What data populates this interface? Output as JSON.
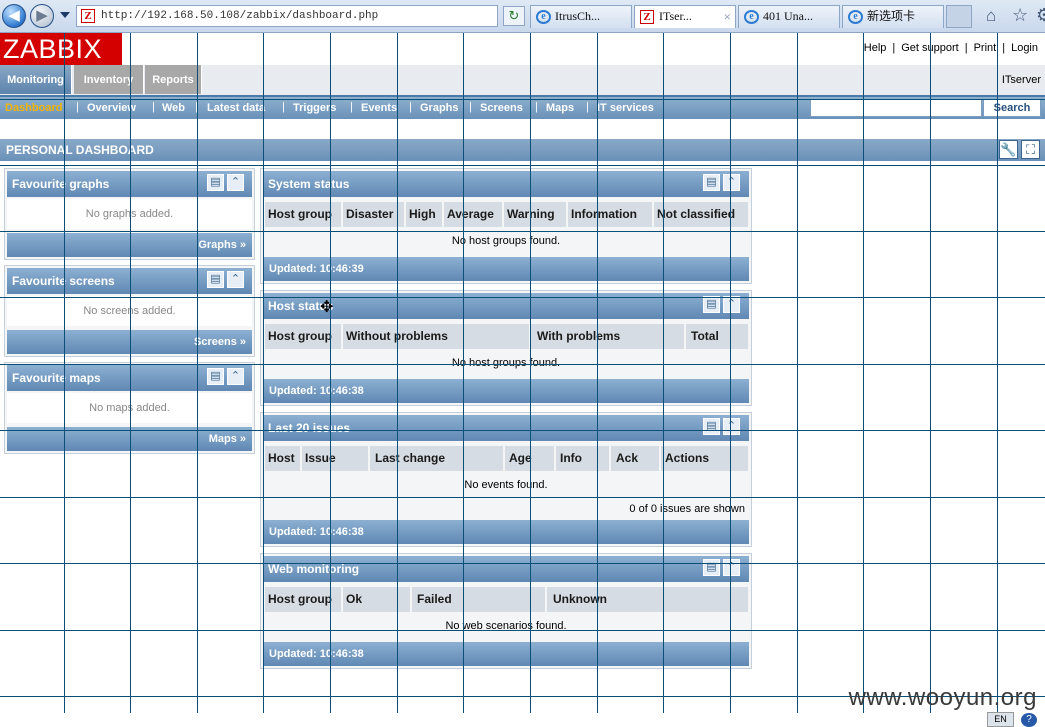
{
  "browser": {
    "address": "http://192.168.50.108/zabbix/dashboard.php",
    "tabs": [
      {
        "label": "ItrusCh...",
        "icon": "ie-icon"
      },
      {
        "label": "ITser...",
        "icon": "zabbix-icon",
        "close": "×"
      },
      {
        "label": "401 Una...",
        "icon": "ie-icon"
      },
      {
        "label": "新选项卡",
        "icon": "ie-icon"
      }
    ]
  },
  "header": {
    "logo": "ZABBIX",
    "links": [
      "Help",
      "Get support",
      "Print",
      "Login"
    ],
    "separator": "|",
    "server": "ITserver"
  },
  "menu": {
    "tabs": [
      "Monitoring",
      "Inventory",
      "Reports"
    ],
    "submenu": [
      "Dashboard",
      "Overview",
      "Web",
      "Latest data",
      "Triggers",
      "Events",
      "Graphs",
      "Screens",
      "Maps",
      "IT services"
    ],
    "search_button": "Search"
  },
  "page_title": "PERSONAL DASHBOARD",
  "favourites": [
    {
      "title": "Favourite graphs",
      "empty": "No graphs added.",
      "link": "Graphs »"
    },
    {
      "title": "Favourite screens",
      "empty": "No screens added.",
      "link": "Screens »"
    },
    {
      "title": "Favourite maps",
      "empty": "No maps added.",
      "link": "Maps »"
    }
  ],
  "system_status": {
    "title": "System status",
    "columns": [
      "Host group",
      "Disaster",
      "High",
      "Average",
      "Warning",
      "Information",
      "Not classified"
    ],
    "empty": "No host groups found.",
    "updated": "Updated: 10:46:39"
  },
  "host_status": {
    "title": "Host status",
    "columns": [
      "Host group",
      "Without problems",
      "With problems",
      "Total"
    ],
    "empty": "No host groups found.",
    "updated": "Updated: 10:46:38"
  },
  "last_issues": {
    "title": "Last 20 issues",
    "columns": [
      "Host",
      "Issue",
      "Last change",
      "Age",
      "Info",
      "Ack",
      "Actions"
    ],
    "empty": "No events found.",
    "summary": "0 of 0 issues are shown",
    "updated": "Updated: 10:46:38"
  },
  "web_monitoring": {
    "title": "Web monitoring",
    "columns": [
      "Host group",
      "Ok",
      "Failed",
      "Unknown"
    ],
    "empty": "No web scenarios found.",
    "updated": "Updated: 10:46:38"
  },
  "footer": {
    "watermark": "www.wooyun.org",
    "lang": "EN"
  }
}
